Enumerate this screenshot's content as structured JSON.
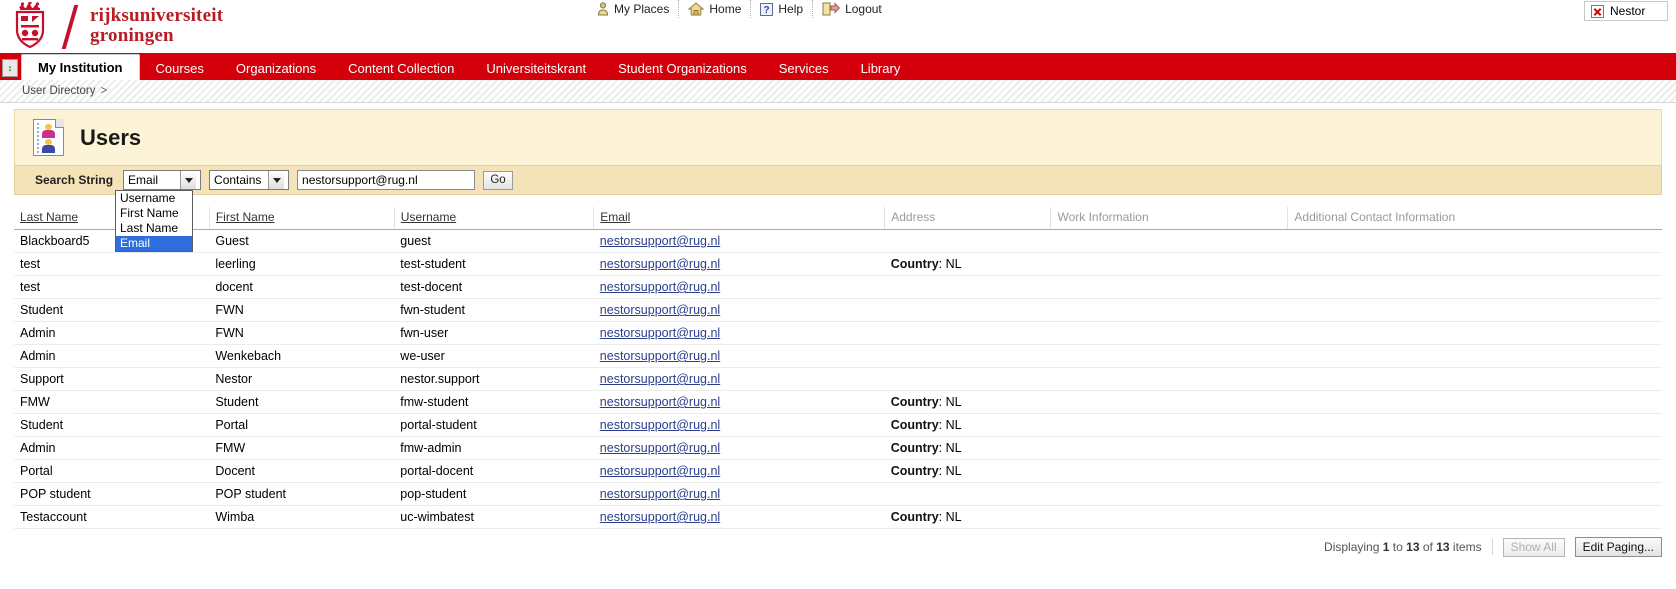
{
  "brand": {
    "line1": "rijksuniversiteit",
    "line2": "groningen",
    "crest_icon": "coat-of-arms-icon"
  },
  "utility_nav": [
    {
      "label": "My Places",
      "icon": "person-icon"
    },
    {
      "label": "Home",
      "icon": "house-icon"
    },
    {
      "label": "Help",
      "icon": "question-mark-icon"
    },
    {
      "label": "Logout",
      "icon": "logout-door-icon"
    }
  ],
  "session_box": {
    "label": "Nestor",
    "icon": "red-x-icon"
  },
  "nav": {
    "toggle_icon": "collapse-toggle-icon",
    "tabs": [
      {
        "label": "My Institution",
        "active": true
      },
      {
        "label": "Courses",
        "active": false
      },
      {
        "label": "Organizations",
        "active": false
      },
      {
        "label": "Content Collection",
        "active": false
      },
      {
        "label": "Universiteitskrant",
        "active": false
      },
      {
        "label": "Student Organizations",
        "active": false
      },
      {
        "label": "Services",
        "active": false
      },
      {
        "label": "Library",
        "active": false
      }
    ]
  },
  "breadcrumb": {
    "items": [
      "User Directory"
    ],
    "separator": ">"
  },
  "page": {
    "title": "Users",
    "icon": "users-page-icon"
  },
  "search": {
    "label": "Search String",
    "field_select": {
      "value": "Email",
      "options": [
        "Username",
        "First Name",
        "Last Name",
        "Email"
      ],
      "selected_option": "Email",
      "open": true
    },
    "operator_select": {
      "value": "Contains",
      "options": [
        "Contains"
      ]
    },
    "input_value": "nestorsupport@rug.nl",
    "input_placeholder": "",
    "go_label": "Go"
  },
  "table": {
    "columns": [
      {
        "key": "last_name",
        "label": "Last Name",
        "sortable": true,
        "muted": false
      },
      {
        "key": "blank",
        "label": "",
        "sortable": false,
        "muted": false
      },
      {
        "key": "first_name",
        "label": "First Name",
        "sortable": true,
        "muted": false
      },
      {
        "key": "username",
        "label": "Username",
        "sortable": true,
        "muted": false
      },
      {
        "key": "email",
        "label": "Email",
        "sortable": true,
        "muted": false
      },
      {
        "key": "address",
        "label": "Address",
        "sortable": false,
        "muted": true
      },
      {
        "key": "work_information",
        "label": "Work Information",
        "sortable": false,
        "muted": true
      },
      {
        "key": "additional_contact",
        "label": "Additional Contact Information",
        "sortable": false,
        "muted": true
      }
    ],
    "rows": [
      {
        "last_name": "Blackboard5",
        "first_name": "Guest",
        "username": "guest",
        "email": "nestorsupport@rug.nl",
        "address_label": "",
        "address_value": ""
      },
      {
        "last_name": "test",
        "first_name": "leerling",
        "username": "test-student",
        "email": "nestorsupport@rug.nl",
        "address_label": "Country",
        "address_value": "NL"
      },
      {
        "last_name": "test",
        "first_name": "docent",
        "username": "test-docent",
        "email": "nestorsupport@rug.nl",
        "address_label": "",
        "address_value": ""
      },
      {
        "last_name": "Student",
        "first_name": "FWN",
        "username": "fwn-student",
        "email": "nestorsupport@rug.nl",
        "address_label": "",
        "address_value": ""
      },
      {
        "last_name": "Admin",
        "first_name": "FWN",
        "username": "fwn-user",
        "email": "nestorsupport@rug.nl",
        "address_label": "",
        "address_value": ""
      },
      {
        "last_name": "Admin",
        "first_name": "Wenkebach",
        "username": "we-user",
        "email": "nestorsupport@rug.nl",
        "address_label": "",
        "address_value": ""
      },
      {
        "last_name": "Support",
        "first_name": "Nestor",
        "username": "nestor.support",
        "email": "nestorsupport@rug.nl",
        "address_label": "",
        "address_value": ""
      },
      {
        "last_name": "FMW",
        "first_name": "Student",
        "username": "fmw-student",
        "email": "nestorsupport@rug.nl",
        "address_label": "Country",
        "address_value": "NL"
      },
      {
        "last_name": "Student",
        "first_name": "Portal",
        "username": "portal-student",
        "email": "nestorsupport@rug.nl",
        "address_label": "Country",
        "address_value": "NL"
      },
      {
        "last_name": "Admin",
        "first_name": "FMW",
        "username": "fmw-admin",
        "email": "nestorsupport@rug.nl",
        "address_label": "Country",
        "address_value": "NL"
      },
      {
        "last_name": "Portal",
        "first_name": "Docent",
        "username": "portal-docent",
        "email": "nestorsupport@rug.nl",
        "address_label": "Country",
        "address_value": "NL"
      },
      {
        "last_name": "POP student",
        "first_name": "POP student",
        "username": "pop-student",
        "email": "nestorsupport@rug.nl",
        "address_label": "",
        "address_value": ""
      },
      {
        "last_name": "Testaccount",
        "first_name": "Wimba",
        "username": "uc-wimbatest",
        "email": "nestorsupport@rug.nl",
        "address_label": "Country",
        "address_value": "NL"
      }
    ]
  },
  "footer": {
    "displaying_prefix": "Displaying",
    "range_start": "1",
    "range_mid": "to",
    "range_end": "13",
    "of_text": "of",
    "total": "13",
    "items_text": "items",
    "show_all_label": "Show All",
    "edit_paging_label": "Edit Paging..."
  },
  "colors": {
    "nav_red": "#d3000b",
    "brand_red": "#b81d26",
    "header_cream": "#fdf3d6",
    "search_cream": "#f4e3b8",
    "link_blue": "#2b3f8c",
    "select_highlight": "#2f6fdd"
  }
}
